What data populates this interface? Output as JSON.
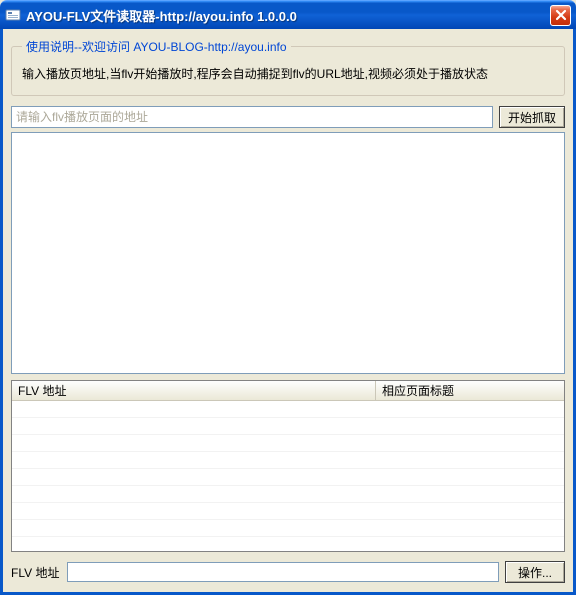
{
  "titlebar": {
    "title": "AYOU-FLV文件读取器-http://ayou.info 1.0.0.0"
  },
  "group": {
    "legend": "使用说明--欢迎访问 AYOU-BLOG-http://ayou.info",
    "instructions": "输入播放页地址,当flv开始播放时,程序会自动捕捉到flv的URL地址,视频必须处于播放状态"
  },
  "urlRow": {
    "placeholder": "请输入flv播放页面的地址",
    "value": "",
    "captureButton": "开始抓取"
  },
  "table": {
    "col1": "FLV 地址",
    "col2": "相应页面标题",
    "rows": []
  },
  "bottom": {
    "label": "FLV 地址",
    "value": "",
    "opButton": "操作..."
  }
}
